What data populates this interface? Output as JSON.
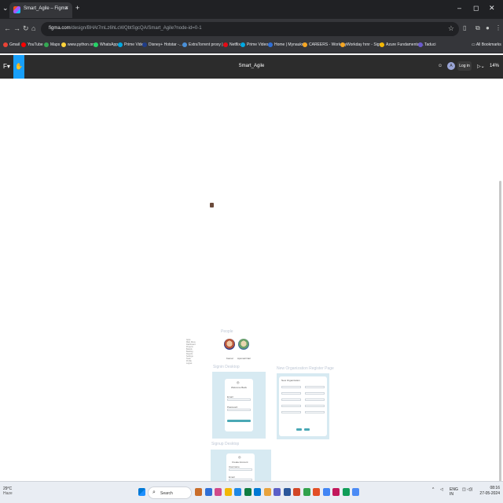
{
  "browser": {
    "tab_title": "Smart_Agile – Figma",
    "tab_close": "×",
    "new_tab": "+",
    "url_host": "figma.com",
    "url_path": "/design/BHAt7mLz6hLcWQbtSgcQA/Smart_Agile?node-id=0-1",
    "window_controls": [
      "–",
      "◻",
      "✕"
    ]
  },
  "bookmarks": [
    {
      "label": "Gmail",
      "color": "#ea4335"
    },
    {
      "label": "YouTube",
      "color": "#ff0000"
    },
    {
      "label": "Maps",
      "color": "#34a853"
    },
    {
      "label": "www.python.org",
      "color": "#ffd43b"
    },
    {
      "label": "WhatsApp",
      "color": "#25d366"
    },
    {
      "label": "Prime Video",
      "color": "#00a8e1"
    },
    {
      "label": "Disney+ Hotstar -...",
      "color": "#1f3c88"
    },
    {
      "label": "ExtraTorrent proxy |...",
      "color": "#4a90d9"
    },
    {
      "label": "Netflix",
      "color": "#e50914"
    },
    {
      "label": "Prime Video",
      "color": "#00a8e1"
    },
    {
      "label": "Home | Mynaukri",
      "color": "#2f6fd6"
    },
    {
      "label": "CAREERS - Workday",
      "color": "#f5a623"
    },
    {
      "label": "Workday hrnr - Sign...",
      "color": "#f5a623"
    },
    {
      "label": "Azure Fundamental...",
      "color": "#f2b705"
    },
    {
      "label": "Taduci",
      "color": "#6a5acd"
    }
  ],
  "all_bookmarks": "All Bookmarks",
  "figma": {
    "file_title": "Smart_Agile",
    "login": "Log in",
    "avatar_initial": "A",
    "zoom": "14%"
  },
  "canvas": {
    "people_label": "People",
    "person1_caption": "Kamal",
    "person2_caption": "Apsmail Nair",
    "signin_label": "Signin Desktop",
    "signup_label": "Signup Desktop",
    "register_label": "New Organization Register Page",
    "welcome_back": "Welcome Back",
    "signup_header": "Create Account",
    "register_header": "New Organization",
    "email_label": "Email",
    "password_label": "Password",
    "username_label": "Username",
    "button_label": "Sign In",
    "left_list": [
      "Apps",
      "Main Menu",
      "Dashboard",
      "Projects",
      "Boards",
      "Backlog",
      "Reports",
      "Settings",
      "Team",
      "Profile",
      "Logout"
    ]
  },
  "taskbar": {
    "temp": "29°C",
    "weather": "Haze",
    "search": "Search",
    "lang1": "ENG",
    "lang2": "IN",
    "time": "08:16",
    "date": "27-05-2024",
    "app_colors": [
      "#c96d2a",
      "#2f6fd6",
      "#d04a8a",
      "#f2b705",
      "#1e88e5",
      "#107c41",
      "#0078d4",
      "#e8a33d",
      "#5b5fc7",
      "#2b579a",
      "#d24726",
      "#31a24c",
      "#e34f26",
      "#4285f4",
      "#c2185b",
      "#0f9d58",
      "#4c8bf5"
    ]
  }
}
